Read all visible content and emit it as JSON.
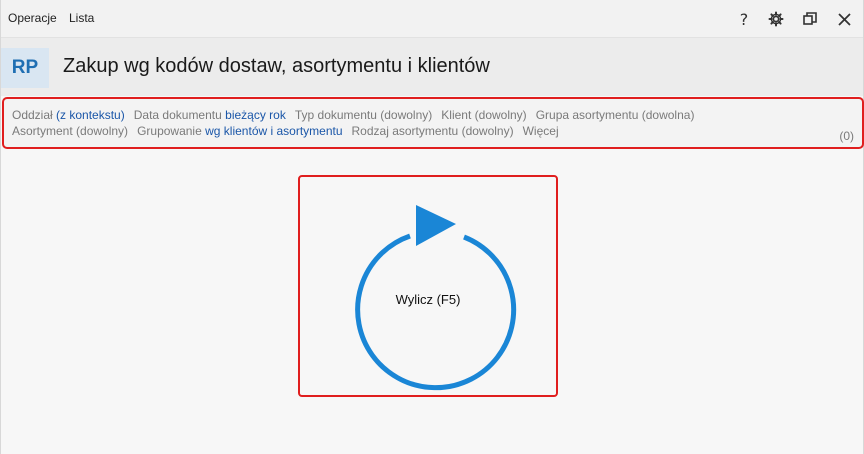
{
  "menu": {
    "operacje": "Operacje",
    "lista": "Lista"
  },
  "window_controls": {
    "help": "?",
    "help_icon": "question-icon",
    "settings_icon": "gear-icon",
    "restore_icon": "restore-window-icon",
    "close_icon": "close-icon"
  },
  "header": {
    "badge": "RP",
    "title": "Zakup wg kodów dostaw, asortymentu i klientów"
  },
  "filters": {
    "row1": [
      {
        "label": "Oddział",
        "value": "(z kontekstu)",
        "value_is_link": true
      },
      {
        "label": "Data dokumentu",
        "value": "bieżący rok",
        "value_is_link": true
      },
      {
        "label": "Typ dokumentu",
        "value": "(dowolny)",
        "value_is_link": false
      },
      {
        "label": "Klient",
        "value": "(dowolny)",
        "value_is_link": false
      },
      {
        "label": "Grupa asortymentu",
        "value": "(dowolna)",
        "value_is_link": false
      }
    ],
    "row2": [
      {
        "label": "Asortyment",
        "value": "(dowolny)",
        "value_is_link": false
      },
      {
        "label": "Grupowanie",
        "value": "wg klientów i asortymentu",
        "value_is_link": true
      },
      {
        "label": "Rodzaj asortymentu",
        "value": "(dowolny)",
        "value_is_link": false
      },
      {
        "label": "Więcej",
        "value": "",
        "value_is_link": false
      }
    ],
    "count": "(0)"
  },
  "compute": {
    "label": "Wylicz (F5)",
    "icon": "refresh-play-icon",
    "color": "#1a86d6"
  },
  "colors": {
    "accent_blue": "#1a86d6",
    "link_blue": "#1a56a8",
    "highlight_red": "#e01e1e",
    "badge_bg": "#d9e6f2"
  }
}
